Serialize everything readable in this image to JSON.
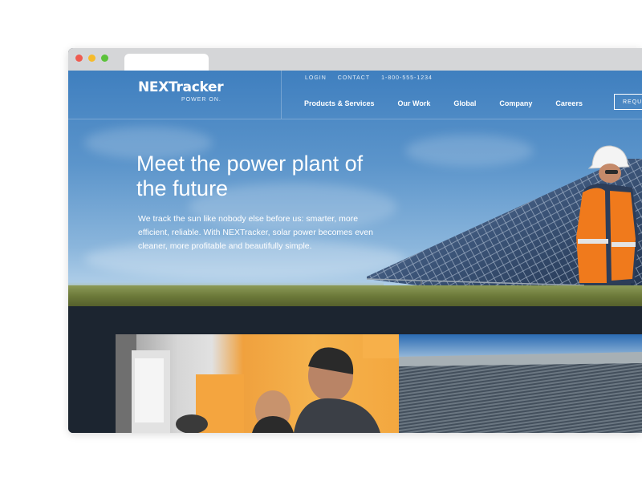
{
  "brand": {
    "name": "NEXTracker",
    "tagline": "POWER ON."
  },
  "utility_nav": {
    "login": "LOGIN",
    "contact": "CONTACT",
    "phone": "1-800-555-1234"
  },
  "main_nav": [
    {
      "label": "Products & Services"
    },
    {
      "label": "Our Work"
    },
    {
      "label": "Global"
    },
    {
      "label": "Company"
    },
    {
      "label": "Careers"
    }
  ],
  "cta": {
    "label": "REQUE"
  },
  "hero": {
    "headline": "Meet the power plant of the future",
    "subtext": "We track the sun like nobody else before us: smarter, more efficient, reliable. With NEXTracker, solar power becomes even cleaner, more profitable and beautifully simple."
  },
  "colors": {
    "sky": "#4a86c4",
    "dark_band": "#1c2530",
    "safety_vest": "#f07a1c"
  },
  "icons": [
    "window-close-icon",
    "window-minimize-icon",
    "window-maximize-icon"
  ]
}
